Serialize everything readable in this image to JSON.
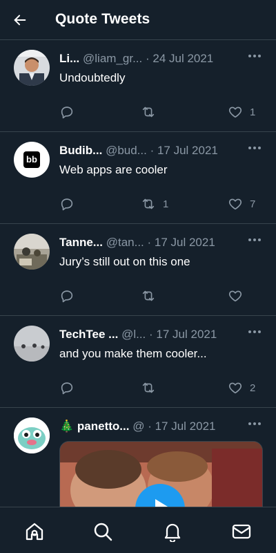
{
  "header": {
    "title": "Quote Tweets",
    "back_icon": "arrow-left-icon"
  },
  "tweets": [
    {
      "name": "Li...",
      "handle": "@liam_gr...",
      "date": "24 Jul 2021",
      "text": "Undoubtedly",
      "replies": "",
      "retweets": "",
      "likes": "1"
    },
    {
      "name": "Budib...",
      "handle": "@bud...",
      "date": "17 Jul 2021",
      "text": "Web apps are cooler",
      "avatar_text": "bb",
      "replies": "",
      "retweets": "1",
      "likes": "7"
    },
    {
      "name": "Tanne...",
      "handle": "@tan...",
      "date": "17 Jul 2021",
      "text": "Jury’s still out on this one",
      "replies": "",
      "retweets": "",
      "likes": ""
    },
    {
      "name": "TechTee ...",
      "handle": "@l...",
      "date": "17 Jul 2021",
      "text": "and you make them cooler...",
      "replies": "",
      "retweets": "",
      "likes": "2"
    },
    {
      "emoji": "🎄",
      "name": "panetto...",
      "handle": "@",
      "date": "17 Jul 2021"
    }
  ],
  "separator": " · ",
  "bottom_nav": [
    "home-icon",
    "search-icon",
    "notifications-icon",
    "messages-icon"
  ],
  "colors": {
    "background": "#15202b",
    "divider": "#38444d",
    "muted": "#8b98a5",
    "accent": "#1d9bf0"
  }
}
